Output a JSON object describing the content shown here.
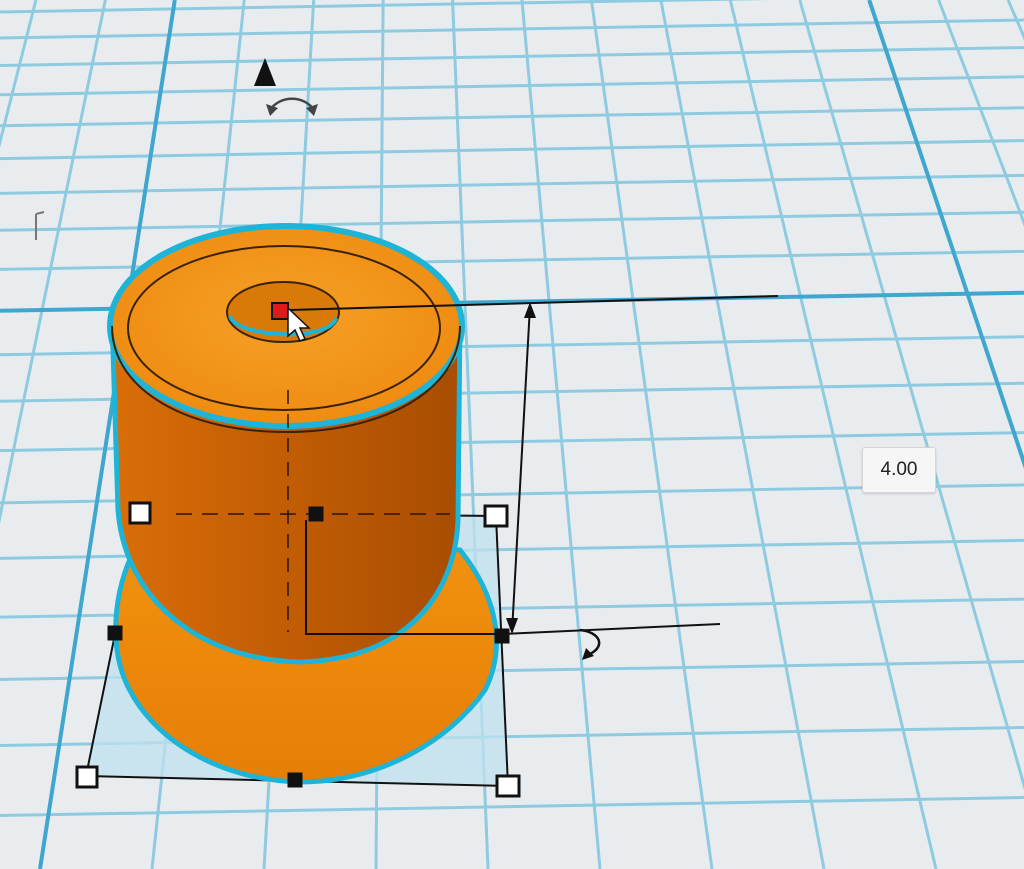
{
  "dimension": {
    "height_value": "4.00"
  },
  "icons": {
    "lift": "cone-lift-icon",
    "rotate_top": "rotate-arrow-icon",
    "rotate_side": "rotate-arrow-icon",
    "cursor": "mouse-pointer-icon"
  },
  "colors": {
    "shape_orange": "#f08a10",
    "selection_outline": "#1eb4d8",
    "grid_line": "#8fcbe0",
    "grid_major": "#3ea6cf",
    "footprint": "#bfe2ef",
    "center_handle": "#e01a1a"
  }
}
